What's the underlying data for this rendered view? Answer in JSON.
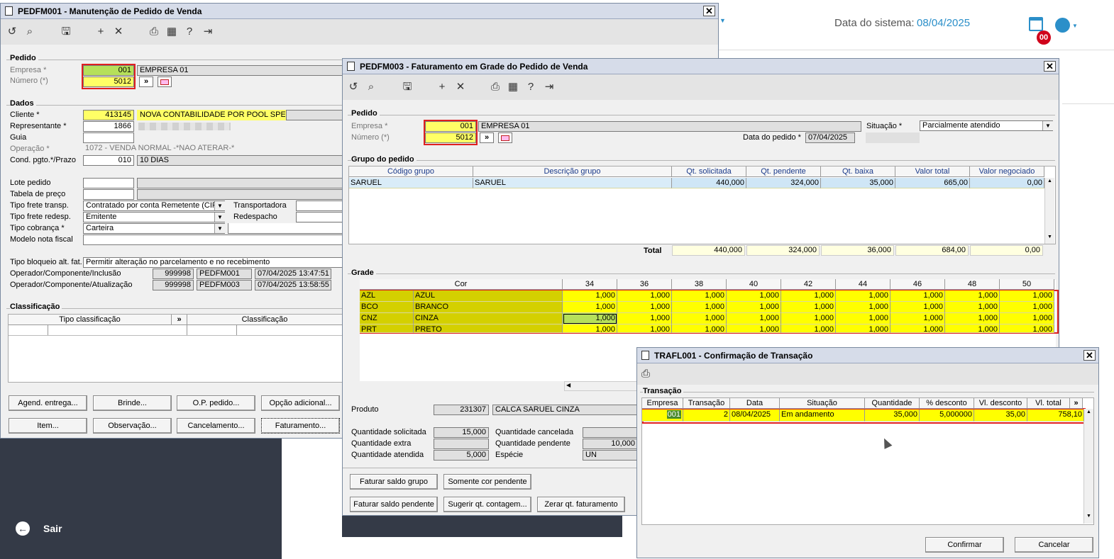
{
  "background_app": {
    "system_date_label": "Data do sistema:",
    "system_date_value": "08/04/2025",
    "notif_badge": "00",
    "exit_label": "Sair"
  },
  "win1": {
    "title": "PEDFM001 - Manutenção de Pedido de Venda",
    "close": "✕",
    "pedido": {
      "section": "Pedido",
      "empresa_label": "Empresa *",
      "empresa_code": "001",
      "empresa_name": "EMPRESA 01",
      "numero_label": "Número (*)",
      "numero_value": "5012",
      "next_btn": "»"
    },
    "dados": {
      "section": "Dados",
      "cliente_label": "Cliente *",
      "cliente_code": "413145",
      "cliente_name": "NOVA CONTABILIDADE POR POOL SPED",
      "representante_label": "Representante *",
      "representante_code": "1866",
      "guia_label": "Guia",
      "operacao_label": "Operação *",
      "operacao_value": "1072 - VENDA NORMAL -*NAO ATERAR-*",
      "cond_label": "Cond. pgto.*/Prazo",
      "cond_code": "010",
      "cond_name": "10 DIAS",
      "lote_label": "Lote pedido",
      "tabela_label": "Tabela de preço",
      "frete_label": "Tipo frete transp.",
      "frete_value": "Contratado por conta Remetente (CIF)",
      "transportadora_label": "Transportadora",
      "frete_redesp_label": "Tipo frete redesp.",
      "frete_redesp_value": "Emitente",
      "redespacho_label": "Redespacho",
      "cobranca_label": "Tipo cobrança *",
      "cobranca_value": "Carteira",
      "modelo_label": "Modelo nota fiscal",
      "bloqueio_label": "Tipo bloqueio alt. fat.",
      "bloqueio_value": "Permitir alteração no parcelamento e no recebimento",
      "op_incl_label": "Operador/Componente/Inclusão",
      "op_incl_code": "999998",
      "op_incl_comp": "PEDFM001",
      "op_incl_date": "07/04/2025 13:47:51",
      "op_atu_label": "Operador/Componente/Atualização",
      "op_atu_code": "999998",
      "op_atu_comp": "PEDFM003",
      "op_atu_date": "07/04/2025 13:58:55"
    },
    "classificacao": {
      "section": "Classificação",
      "col1": "Tipo classificação",
      "col_btn": "»",
      "col2": "Classificação"
    },
    "buttons": {
      "agend": "Agend. entrega...",
      "brinde": "Brinde...",
      "op_pedido": "O.P. pedido...",
      "opcao": "Opção adicional...",
      "item": "Item...",
      "observacao": "Observação...",
      "cancelamento": "Cancelamento...",
      "faturamento": "Faturamento..."
    }
  },
  "win2": {
    "title": "PEDFM003 - Faturamento em Grade do Pedido de Venda",
    "close": "✕",
    "pedido": {
      "section": "Pedido",
      "empresa_label": "Empresa *",
      "empresa_code": "001",
      "empresa_name": "EMPRESA 01",
      "numero_label": "Número (*)",
      "numero_value": "5012",
      "next_btn": "»",
      "data_label": "Data do pedido *",
      "data_value": "07/04/2025",
      "situacao_label": "Situação *",
      "situacao_value": "Parcialmente atendido"
    },
    "grupo": {
      "section": "Grupo do pedido",
      "headers": [
        "Código grupo",
        "Descrição grupo",
        "Qt. solicitada",
        "Qt. pendente",
        "Qt. baixa",
        "Valor total",
        "Valor  negociado"
      ],
      "row": [
        "SARUEL",
        "SARUEL",
        "440,000",
        "324,000",
        "35,000",
        "665,00",
        "0,00"
      ],
      "total_label": "Total",
      "totals": [
        "440,000",
        "324,000",
        "36,000",
        "684,00",
        "0,00"
      ]
    },
    "grade": {
      "section": "Grade",
      "cor_header": "Cor",
      "sizes": [
        "34",
        "36",
        "38",
        "40",
        "42",
        "44",
        "46",
        "48",
        "50"
      ],
      "rows": [
        {
          "code": "AZL",
          "name": "AZUL",
          "vals": [
            "1,000",
            "1,000",
            "1,000",
            "1,000",
            "1,000",
            "1,000",
            "1,000",
            "1,000",
            "1,000"
          ]
        },
        {
          "code": "BCO",
          "name": "BRANCO",
          "vals": [
            "1,000",
            "1,000",
            "1,000",
            "1,000",
            "1,000",
            "1,000",
            "1,000",
            "1,000",
            "1,000"
          ]
        },
        {
          "code": "CNZ",
          "name": "CINZA",
          "vals": [
            "1,000",
            "1,000",
            "1,000",
            "1,000",
            "1,000",
            "1,000",
            "1,000",
            "1,000",
            "1,000"
          ]
        },
        {
          "code": "PRT",
          "name": "PRETO",
          "vals": [
            "1,000",
            "1,000",
            "1,000",
            "1,000",
            "1,000",
            "1,000",
            "1,000",
            "1,000",
            "1,000"
          ]
        }
      ]
    },
    "produto": {
      "produto_label": "Produto",
      "produto_code": "231307",
      "produto_name": "CALCA SARUEL CINZA",
      "qt_sol_label": "Quantidade solicitada",
      "qt_sol_value": "15,000",
      "qt_canc_label": "Quantidade cancelada",
      "qt_extra_label": "Quantidade extra",
      "qt_pend_label": "Quantidade pendente",
      "qt_pend_value": "10,000",
      "qt_at_label": "Quantidade atendida",
      "qt_at_value": "5,000",
      "especie_label": "Espécie",
      "especie_value": "UN"
    },
    "buttons": {
      "fat_saldo_grupo": "Faturar saldo grupo",
      "somente_cor": "Somente cor pendente",
      "fat_saldo_pend": "Faturar saldo pendente",
      "sugerir": "Sugerir qt. contagem...",
      "zerar": "Zerar qt. faturamento"
    }
  },
  "win3": {
    "title": "TRAFL001 - Confirmação de Transação",
    "close": "✕",
    "section": "Transação",
    "headers": [
      "Empresa",
      "Transação",
      "Data",
      "Situação",
      "Quantidade",
      "% desconto",
      "Vl. desconto",
      "Vl. total",
      "»"
    ],
    "row": [
      "001",
      "2",
      "08/04/2025",
      "Em andamento",
      "35,000",
      "5,000000",
      "35,00",
      "758,10"
    ],
    "confirm": "Confirmar",
    "cancel": "Cancelar"
  },
  "colors": {
    "accent": "#2b8fc9",
    "highlight": "#ffff66",
    "selected": "#b6e05a",
    "red": "#e02020",
    "dark_panel": "#343a47"
  }
}
